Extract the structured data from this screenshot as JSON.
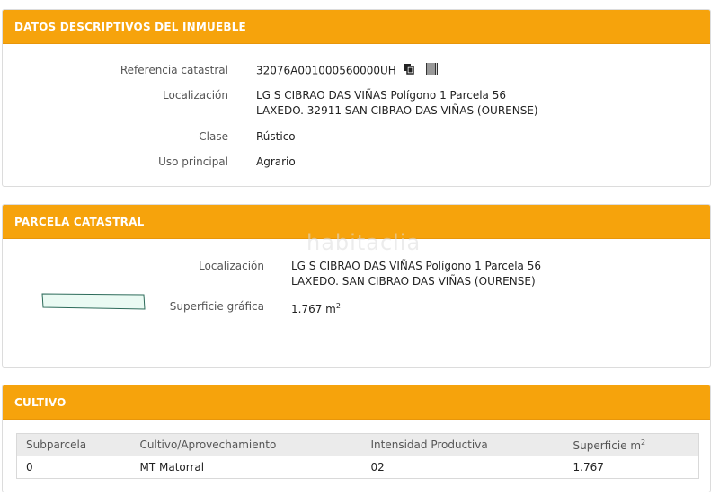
{
  "panel1": {
    "title": "DATOS DESCRIPTIVOS DEL INMUEBLE",
    "rows": [
      {
        "label": "Referencia catastral",
        "value": "32076A001000560000UH"
      },
      {
        "label": "Localización",
        "line1": "LG S CIBRAO DAS VIÑAS Polígono 1 Parcela 56",
        "line2": "LAXEDO. 32911 SAN CIBRAO DAS VIÑAS (OURENSE)"
      },
      {
        "label": "Clase",
        "value": "Rústico"
      },
      {
        "label": "Uso principal",
        "value": "Agrario"
      }
    ],
    "icons": [
      "copy-icon",
      "barcode-icon"
    ]
  },
  "panel2": {
    "title": "PARCELA CATASTRAL",
    "watermark": "habitaclia",
    "localizacion_label": "Localización",
    "localizacion_line1": "LG S CIBRAO DAS VIÑAS Polígono 1 Parcela 56",
    "localizacion_line2": "LAXEDO. SAN CIBRAO DAS VIÑAS (OURENSE)",
    "superficie_label": "Superficie gráfica",
    "superficie_value": "1.767 m",
    "superficie_unit_sup": "2"
  },
  "panel3": {
    "title": "CULTIVO",
    "columns": [
      "Subparcela",
      "Cultivo/Aprovechamiento",
      "Intensidad Productiva",
      "Superficie m"
    ],
    "last_col_sup": "2",
    "rows": [
      [
        "0",
        "MT Matorral",
        "02",
        "1.767"
      ]
    ]
  },
  "colors": {
    "header": "#f6a30c",
    "header_text": "#ffffff",
    "table_header_bg": "#ebebeb"
  }
}
